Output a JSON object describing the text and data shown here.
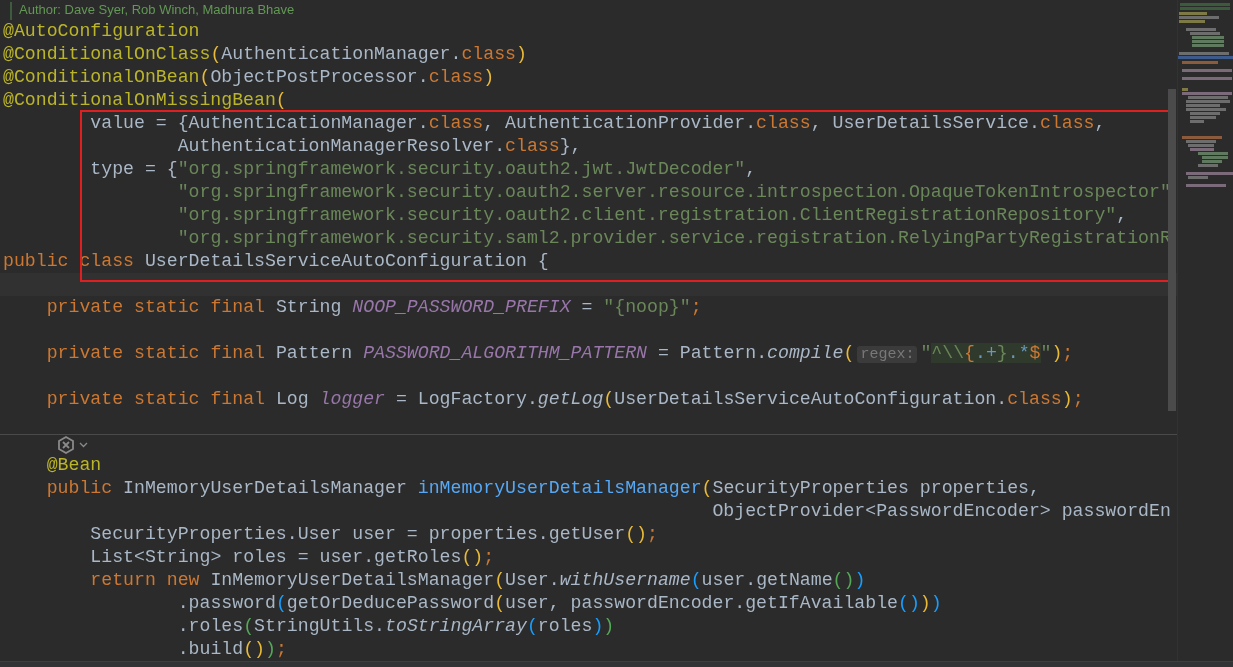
{
  "editor": {
    "sections": [
      {
        "kind": "plain",
        "lines": [
          {
            "kind": "doc",
            "text": "Author: Dave Syer, Rob Winch, Madhura Bhave"
          },
          {
            "kind": "code",
            "tokens": [
              {
                "text": "@AutoConfiguration",
                "kind": "annotation"
              }
            ]
          },
          {
            "kind": "code",
            "tokens": [
              {
                "text": "@ConditionalOnClass",
                "kind": "annotation"
              },
              {
                "text": "(",
                "kind": "gold"
              },
              {
                "text": "AuthenticationManager.",
                "kind": "plain"
              },
              {
                "text": "class",
                "kind": "keyword"
              },
              {
                "text": ")",
                "kind": "gold"
              }
            ]
          },
          {
            "kind": "code",
            "tokens": [
              {
                "text": "@ConditionalOnBean",
                "kind": "annotation"
              },
              {
                "text": "(",
                "kind": "gold"
              },
              {
                "text": "ObjectPostProcessor.",
                "kind": "plain"
              },
              {
                "text": "class",
                "kind": "keyword"
              },
              {
                "text": ")",
                "kind": "gold"
              }
            ]
          },
          {
            "kind": "code",
            "tokens": [
              {
                "text": "@ConditionalOnMissingBean",
                "kind": "annotation"
              },
              {
                "text": "(",
                "kind": "gold"
              }
            ]
          }
        ]
      },
      {
        "kind": "framed",
        "lines": [
          {
            "kind": "code",
            "tokens": [
              {
                "text": "        value = {AuthenticationManager.",
                "kind": "plain"
              },
              {
                "text": "class",
                "kind": "keyword"
              },
              {
                "text": ", AuthenticationProvider.",
                "kind": "plain"
              },
              {
                "text": "class",
                "kind": "keyword"
              },
              {
                "text": ", UserDetailsService.",
                "kind": "plain"
              },
              {
                "text": "class",
                "kind": "keyword"
              },
              {
                "text": ",",
                "kind": "plain"
              }
            ]
          },
          {
            "kind": "code",
            "tokens": [
              {
                "text": "                AuthenticationManagerResolver.",
                "kind": "plain"
              },
              {
                "text": "class",
                "kind": "keyword"
              },
              {
                "text": "},",
                "kind": "plain"
              }
            ]
          },
          {
            "kind": "code",
            "tokens": [
              {
                "text": "        type = {",
                "kind": "plain"
              },
              {
                "text": "\"org.springframework.security.oauth2.jwt.JwtDecoder\"",
                "kind": "string"
              },
              {
                "text": ",",
                "kind": "plain"
              }
            ]
          },
          {
            "kind": "code",
            "tokens": [
              {
                "text": "                \"org.springframework.security.oauth2.server.resource.introspection.OpaqueTokenIntrospector\"",
                "kind": "string"
              }
            ]
          },
          {
            "kind": "code",
            "tokens": [
              {
                "text": "                \"org.springframework.security.oauth2.client.registration.ClientRegistrationRepository\"",
                "kind": "string"
              },
              {
                "text": ",",
                "kind": "plain"
              }
            ]
          },
          {
            "kind": "code",
            "tokens": [
              {
                "text": "                \"org.springframework.security.saml2.provider.service.registration.RelyingPartyRegistrationR",
                "kind": "string"
              }
            ]
          },
          {
            "kind": "code",
            "tokens": [
              {
                "text": "public class",
                "kind": "keyword"
              },
              {
                "text": " UserDetailsServiceAutoConfiguration {",
                "kind": "plain"
              }
            ]
          }
        ]
      },
      {
        "kind": "plain",
        "lines": [
          {
            "kind": "current"
          },
          {
            "kind": "code",
            "tokens": [
              {
                "text": "    private static final",
                "kind": "keyword"
              },
              {
                "text": " String ",
                "kind": "plain"
              },
              {
                "text": "NOOP_PASSWORD_PREFIX",
                "kind": "constant"
              },
              {
                "text": " = ",
                "kind": "plain"
              },
              {
                "text": "\"{noop}\"",
                "kind": "string"
              },
              {
                "text": ";",
                "kind": "keyword"
              }
            ]
          },
          {
            "kind": "blank"
          },
          {
            "kind": "code",
            "tokens": [
              {
                "text": "    private static final",
                "kind": "keyword"
              },
              {
                "text": " Pattern ",
                "kind": "plain"
              },
              {
                "text": "PASSWORD_ALGORITHM_PATTERN",
                "kind": "constant"
              },
              {
                "text": " = Pattern.",
                "kind": "plain"
              },
              {
                "text": "compile",
                "kind": "italic"
              },
              {
                "text": "(",
                "kind": "gold"
              },
              {
                "text": "regex:",
                "kind": "hint"
              },
              {
                "text": "\"",
                "kind": "string"
              },
              {
                "text": "^\\\\",
                "kind": "regex"
              },
              {
                "text": "{",
                "kind": "regexbrace"
              },
              {
                "text": ".+",
                "kind": "regexmeta"
              },
              {
                "text": "}",
                "kind": "regex"
              },
              {
                "text": ".*",
                "kind": "regexmeta"
              },
              {
                "text": "$",
                "kind": "regexbrace"
              },
              {
                "text": "\"",
                "kind": "string"
              },
              {
                "text": ")",
                "kind": "gold"
              },
              {
                "text": ";",
                "kind": "keyword"
              }
            ]
          },
          {
            "kind": "blank"
          },
          {
            "kind": "code",
            "tokens": [
              {
                "text": "    private static final",
                "kind": "keyword"
              },
              {
                "text": " Log ",
                "kind": "plain"
              },
              {
                "text": "logger",
                "kind": "constant"
              },
              {
                "text": " = LogFactory.",
                "kind": "plain"
              },
              {
                "text": "getLog",
                "kind": "italic"
              },
              {
                "text": "(",
                "kind": "gold"
              },
              {
                "text": "UserDetailsServiceAutoConfiguration.",
                "kind": "plain"
              },
              {
                "text": "class",
                "kind": "keyword"
              },
              {
                "text": ")",
                "kind": "gold"
              },
              {
                "text": ";",
                "kind": "keyword"
              }
            ]
          },
          {
            "kind": "separator"
          },
          {
            "kind": "code",
            "tokens": [
              {
                "text": "    @Bean",
                "kind": "annotation"
              }
            ]
          },
          {
            "kind": "code",
            "tokens": [
              {
                "text": "    public",
                "kind": "keyword"
              },
              {
                "text": " InMemoryUserDetailsManager ",
                "kind": "plain"
              },
              {
                "text": "inMemoryUserDetailsManager",
                "kind": "declaration"
              },
              {
                "text": "(",
                "kind": "gold"
              },
              {
                "text": "SecurityProperties properties,",
                "kind": "plain"
              }
            ]
          },
          {
            "kind": "code",
            "tokens": [
              {
                "text": "                                                                 ObjectProvider<PasswordEncoder> passwordEn",
                "kind": "plain"
              }
            ]
          },
          {
            "kind": "code",
            "tokens": [
              {
                "text": "        SecurityProperties.User user = properties.getUser",
                "kind": "plain"
              },
              {
                "text": "()",
                "kind": "gold"
              },
              {
                "text": ";",
                "kind": "keyword"
              }
            ]
          },
          {
            "kind": "code",
            "tokens": [
              {
                "text": "        List<String> roles = user.getRoles",
                "kind": "plain"
              },
              {
                "text": "()",
                "kind": "gold"
              },
              {
                "text": ";",
                "kind": "keyword"
              }
            ]
          },
          {
            "kind": "code",
            "tokens": [
              {
                "text": "        return new",
                "kind": "keyword"
              },
              {
                "text": " InMemoryUserDetailsManager",
                "kind": "plain"
              },
              {
                "text": "(",
                "kind": "gold"
              },
              {
                "text": "User.",
                "kind": "plain"
              },
              {
                "text": "withUsername",
                "kind": "italic"
              },
              {
                "text": "(",
                "kind": "blue"
              },
              {
                "text": "user.getName",
                "kind": "plain"
              },
              {
                "text": "()",
                "kind": "green"
              },
              {
                "text": ")",
                "kind": "blue"
              }
            ]
          },
          {
            "kind": "code",
            "tokens": [
              {
                "text": "                .password",
                "kind": "plain"
              },
              {
                "text": "(",
                "kind": "blue"
              },
              {
                "text": "getOrDeducePassword",
                "kind": "plain"
              },
              {
                "text": "(",
                "kind": "gold"
              },
              {
                "text": "user, passwordEncoder.getIfAvailable",
                "kind": "plain"
              },
              {
                "text": "()",
                "kind": "blue"
              },
              {
                "text": ")",
                "kind": "gold"
              },
              {
                "text": ")",
                "kind": "blue"
              }
            ]
          },
          {
            "kind": "code",
            "tokens": [
              {
                "text": "                .roles",
                "kind": "plain"
              },
              {
                "text": "(",
                "kind": "green"
              },
              {
                "text": "StringUtils.",
                "kind": "plain"
              },
              {
                "text": "toStringArray",
                "kind": "italic"
              },
              {
                "text": "(",
                "kind": "blue"
              },
              {
                "text": "roles",
                "kind": "plain"
              },
              {
                "text": ")",
                "kind": "blue"
              },
              {
                "text": ")",
                "kind": "green"
              }
            ]
          },
          {
            "kind": "code",
            "tokens": [
              {
                "text": "                .build",
                "kind": "plain"
              },
              {
                "text": "()",
                "kind": "gold"
              },
              {
                "text": ")",
                "kind": "green"
              },
              {
                "text": ";",
                "kind": "keyword"
              }
            ]
          }
        ]
      }
    ]
  }
}
